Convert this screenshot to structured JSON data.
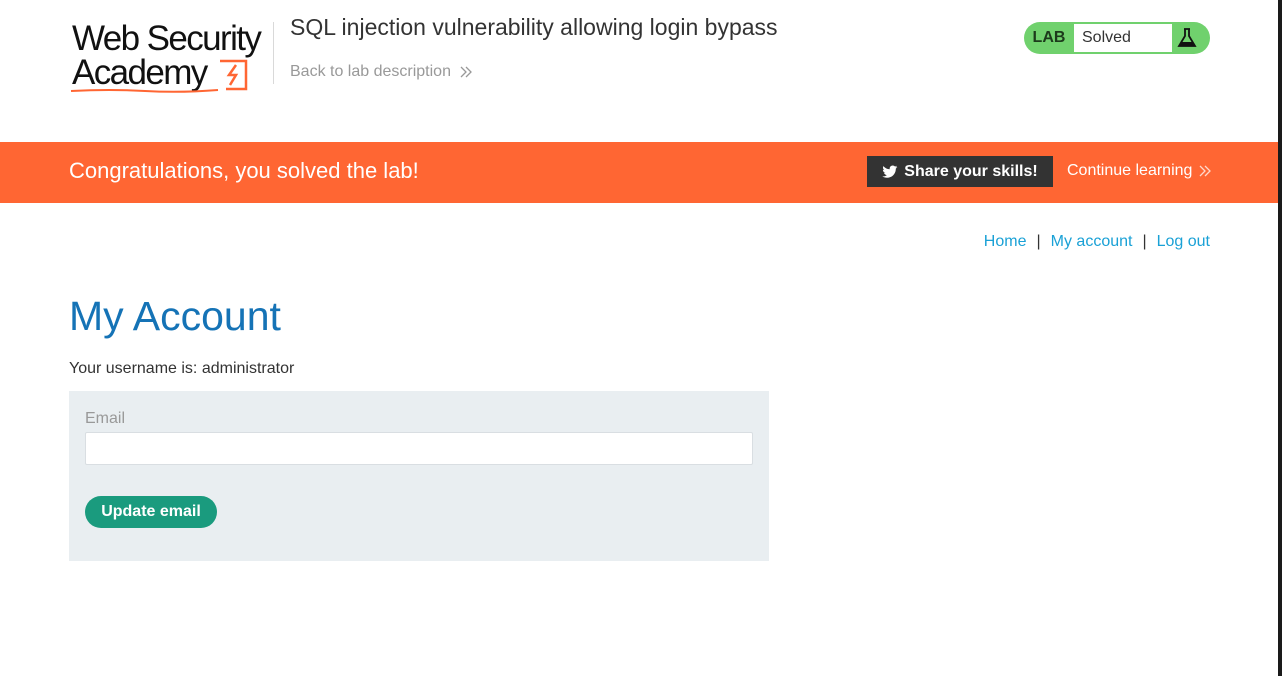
{
  "header": {
    "logo_line1": "Web Security",
    "logo_line2": "Academy",
    "lab_title": "SQL injection vulnerability allowing login bypass",
    "back_link": "Back to lab description",
    "lab_tag": "LAB",
    "lab_status": "Solved",
    "status_color": "#70d16d"
  },
  "banner": {
    "message": "Congratulations, you solved the lab!",
    "share_button": "Share your skills!",
    "continue_link": "Continue learning",
    "background": "#ff6633"
  },
  "nav": {
    "home": "Home",
    "my_account": "My account",
    "log_out": "Log out",
    "separator": "|"
  },
  "main": {
    "title": "My Account",
    "username_text": "Your username is: administrator",
    "email_label": "Email",
    "email_value": "",
    "update_button": "Update email",
    "accent_color": "#1573b6",
    "button_color": "#1a9b7e"
  },
  "icons": {
    "logo_mark": "lightning-bolt-icon",
    "back_chevrons": "double-chevron-right-icon",
    "flask": "flask-icon",
    "twitter": "twitter-icon"
  }
}
